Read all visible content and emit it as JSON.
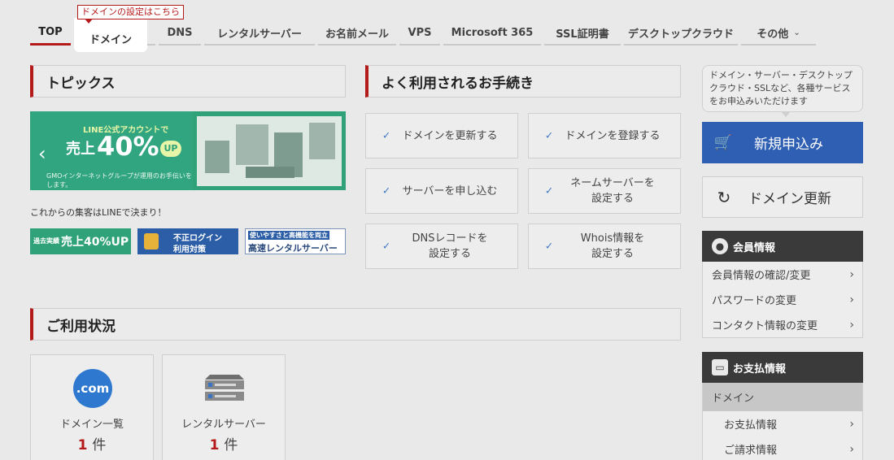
{
  "nav": {
    "items": [
      {
        "label": "TOP",
        "active": true
      },
      {
        "label": "ドメイン"
      },
      {
        "label": "DNS"
      },
      {
        "label": "レンタルサーバー"
      },
      {
        "label": "お名前メール"
      },
      {
        "label": "VPS"
      },
      {
        "label": "Microsoft 365"
      },
      {
        "label": "SSL証明書"
      },
      {
        "label": "デスクトップクラウド"
      },
      {
        "label": "その他"
      }
    ],
    "tooltip": "ドメインの設定はこちら"
  },
  "topics": {
    "title": "トピックス",
    "banner": {
      "line1": "LINE公式アカウントで",
      "sales": "売上",
      "num": "40%",
      "up": "UP",
      "note": "GMOインターネットグループが運用のお手伝いをします。"
    },
    "line_text": "これからの集客はLINEで決まり！",
    "mini_banners": [
      {
        "text_a": "売上40%UP",
        "text_b": "過去実績"
      },
      {
        "text_a": "不正ログイン",
        "text_b": "利用対策"
      },
      {
        "text_a": "使いやすさと高機能を両立",
        "text_b": "高速レンタルサーバー"
      }
    ]
  },
  "procedures": {
    "title": "よく利用されるお手続き",
    "items": [
      {
        "line1": "ドメインを更新する",
        "line2": ""
      },
      {
        "line1": "ドメインを登録する",
        "line2": ""
      },
      {
        "line1": "サーバーを申し込む",
        "line2": ""
      },
      {
        "line1": "ネームサーバーを",
        "line2": "設定する"
      },
      {
        "line1": "DNSレコードを",
        "line2": "設定する"
      },
      {
        "line1": "Whois情報を",
        "line2": "設定する"
      }
    ]
  },
  "usage": {
    "title": "ご利用状況",
    "cards": [
      {
        "icon_text": ".com",
        "label": "ドメイン一覧",
        "count": "1",
        "unit": "件"
      },
      {
        "label": "レンタルサーバー",
        "count": "1",
        "unit": "件"
      }
    ]
  },
  "sidebar": {
    "bubble": "ドメイン・サーバー・デスクトップクラウド・SSLなど、各種サービスをお申込みいただけます",
    "new_label": "新規申込み",
    "renew_label": "ドメイン更新",
    "member": {
      "title": "会員情報",
      "items": [
        "会員情報の確認/変更",
        "パスワードの変更",
        "コンタクト情報の変更"
      ]
    },
    "payment": {
      "title": "お支払情報",
      "section": "ドメイン",
      "items": [
        "お支払情報",
        "ご請求情報"
      ]
    }
  },
  "colors": {
    "accent_red": "#b51a1a",
    "primary_blue": "#2f5fb2",
    "line_green": "#2fa27a"
  }
}
